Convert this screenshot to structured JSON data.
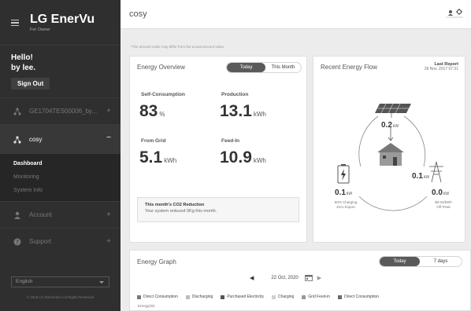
{
  "sidebar": {
    "brand": "LG EnerVu",
    "brand_sub": "For Owner",
    "hello": "Hello!",
    "user": "by lee.",
    "sign_out": "Sign Out",
    "device": "GE1704TES00006_by...",
    "site": "cosy",
    "sub_items": [
      "Dashboard",
      "Monitoring",
      "System Info"
    ],
    "account": "Account",
    "support": "Support",
    "language": "English",
    "copyright": "© 2018 LG Electronics All Rights Reserved"
  },
  "header": {
    "title": "cosy",
    "note": "*The amount value may differ from the actual amount value."
  },
  "overview": {
    "title": "Energy Overview",
    "tabs": [
      "Today",
      "This Month"
    ],
    "self_consumption_label": "Self-Consumption",
    "self_consumption_value": "83",
    "self_consumption_unit": "%",
    "production_label": "Production",
    "production_value": "13.1",
    "production_unit": "kWh",
    "grid_label": "From Grid",
    "grid_value": "5.1",
    "grid_unit": "kWh",
    "feedin_label": "Feed-In",
    "feedin_value": "10.9",
    "feedin_unit": "kWh",
    "co2_title": "This month's CO2 Reduction",
    "co2_text": "Your system reduced 0Kg this month."
  },
  "flow": {
    "title": "Recent Energy Flow",
    "report_label": "Last Report",
    "report_time": "28 Nov, 2017 07:31",
    "solar_value": "0.2",
    "solar_unit": "kW",
    "home_value": "0.1",
    "home_unit": "kW",
    "battery_value": "0.1",
    "battery_unit": "kW",
    "battery_line1": "50% Charging",
    "battery_line2": "Zero Export",
    "grid_value": "0.0",
    "grid_unit": "kW",
    "grid_line1": "$0.03/kWh",
    "grid_line2": "Off Peak"
  },
  "graph": {
    "title": "Energy Graph",
    "tabs": [
      "Today",
      "7 days"
    ],
    "date": "22 Oct, 2020",
    "legend": [
      "Direct Consumption",
      "Discharging",
      "Purchased Electricity",
      "Charging",
      "Grid Feed-in",
      "Direct Consumption"
    ],
    "legend_colors": [
      "#7a7a7a",
      "#bdbdbd",
      "#555555",
      "#d0d0d0",
      "#999999",
      "#6a6a6a"
    ],
    "y_label": "Energy(W)"
  }
}
